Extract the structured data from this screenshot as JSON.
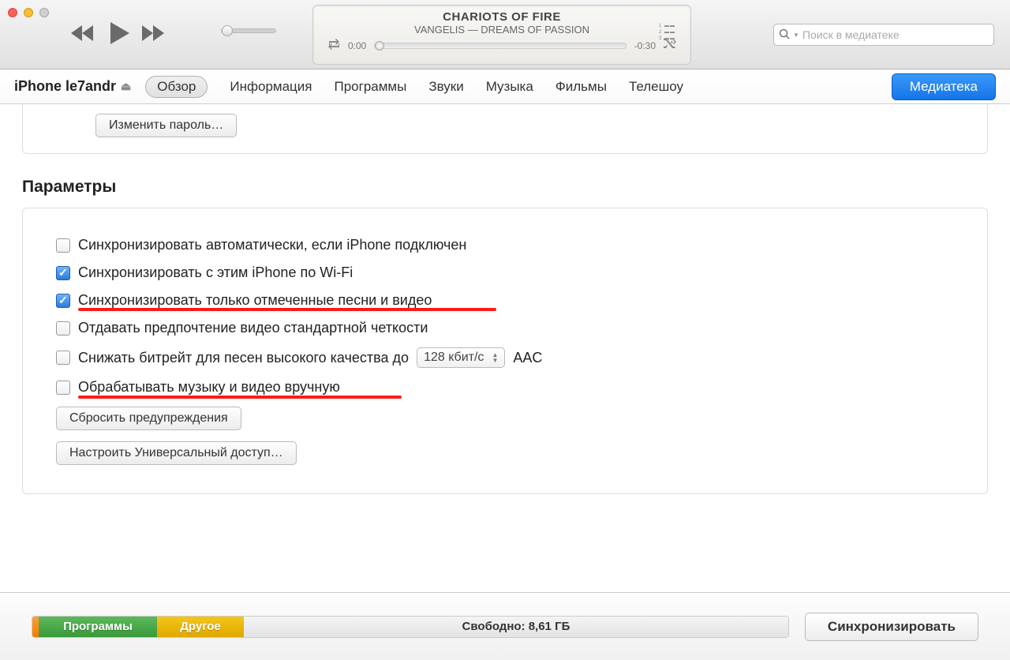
{
  "player": {
    "title": "CHARIOTS OF FIRE",
    "subtitle": "VANGELIS — DREAMS OF PASSION",
    "elapsed": "0:00",
    "remaining": "-0:30"
  },
  "search": {
    "placeholder": "Поиск в медиатеке"
  },
  "device": {
    "name": "iPhone le7andr"
  },
  "tabs": {
    "overview": "Обзор",
    "info": "Информация",
    "programs": "Программы",
    "sounds": "Звуки",
    "music": "Музыка",
    "movies": "Фильмы",
    "tvshows": "Телешоу"
  },
  "buttons": {
    "library": "Медиатека",
    "change_password": "Изменить пароль…",
    "reset_warnings": "Сбросить предупреждения",
    "configure_access": "Настроить Универсальный доступ…",
    "sync": "Синхронизировать"
  },
  "section": {
    "params_title": "Параметры"
  },
  "options": {
    "auto_sync": "Синхронизировать автоматически, если iPhone подключен",
    "wifi_sync": "Синхронизировать с этим iPhone по Wi-Fi",
    "only_checked": "Синхронизировать только отмеченные песни и видео",
    "prefer_sd": "Отдавать предпочтение видео стандартной четкости",
    "lower_bitrate": "Снижать битрейт для песен высокого качества до",
    "bitrate_value": "128 кбит/с",
    "bitrate_codec": "AAC",
    "manual": "Обрабатывать музыку и видео вручную"
  },
  "capacity": {
    "programs": "Программы",
    "other": "Другое",
    "free": "Свободно: 8,61 ГБ"
  }
}
